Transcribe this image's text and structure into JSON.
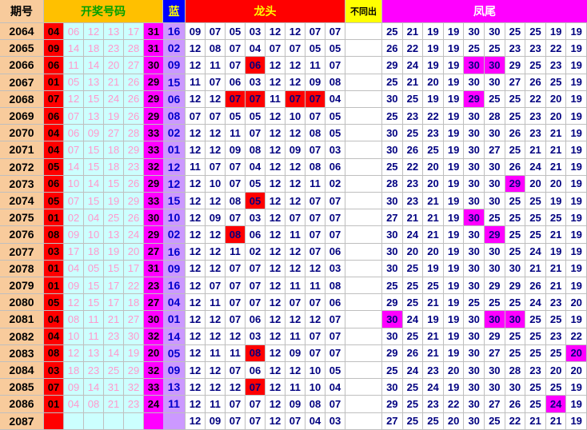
{
  "headers": {
    "period": "期号",
    "numbers": "开奖号码",
    "blue": "蓝",
    "longtou": "龙头",
    "diff": "不同出",
    "fengwei": "凤尾"
  },
  "colors": {
    "header_period_bg": "#f8cb9c",
    "header_numbers_bg": "#ffc000",
    "header_numbers_text": "#00a000",
    "header_blue_bg": "#0000ff",
    "header_blue_text": "#ffff00",
    "header_longtou_bg": "#ff0000",
    "header_longtou_text": "#ffff00",
    "header_diff_bg": "#ffff00",
    "header_fengwei_bg": "#ff00ff",
    "header_fengwei_text": "#ffffff",
    "period_bg": "#f8cb9c",
    "first_bg": "#ff0000",
    "mid_bg": "#ccfffe",
    "mid_text": "#ff99cc",
    "sixth_bg": "#ff00ff",
    "blue_bg": "#cc99ff",
    "blue_text": "#0000cc",
    "grid_text": "#000080",
    "longtou_hl_bg": "#ff0000",
    "fengwei_hl_bg": "#ff00ff"
  },
  "rows": [
    {
      "period": "2064",
      "draw": [
        "04",
        "06",
        "12",
        "13",
        "17",
        "31"
      ],
      "blue": "16",
      "longtou": [
        "09",
        "07",
        "05",
        "03",
        "12",
        "12",
        "07",
        "07"
      ],
      "lt_hl": [],
      "fengwei": [
        "25",
        "21",
        "19",
        "19",
        "30",
        "30",
        "25",
        "25",
        "19",
        "19"
      ],
      "fw_hl": []
    },
    {
      "period": "2065",
      "draw": [
        "09",
        "14",
        "18",
        "23",
        "28",
        "31"
      ],
      "blue": "02",
      "longtou": [
        "12",
        "08",
        "07",
        "04",
        "07",
        "07",
        "05",
        "05"
      ],
      "lt_hl": [],
      "fengwei": [
        "26",
        "22",
        "19",
        "19",
        "25",
        "25",
        "23",
        "23",
        "22",
        "19"
      ],
      "fw_hl": []
    },
    {
      "period": "2066",
      "draw": [
        "06",
        "11",
        "14",
        "20",
        "27",
        "30"
      ],
      "blue": "09",
      "longtou": [
        "12",
        "11",
        "07",
        "06",
        "12",
        "12",
        "11",
        "07"
      ],
      "lt_hl": [
        3
      ],
      "fengwei": [
        "29",
        "24",
        "19",
        "19",
        "30",
        "30",
        "29",
        "25",
        "23",
        "19"
      ],
      "fw_hl": [
        4,
        5
      ]
    },
    {
      "period": "2067",
      "draw": [
        "01",
        "05",
        "13",
        "21",
        "26",
        "29"
      ],
      "blue": "15",
      "longtou": [
        "11",
        "07",
        "06",
        "03",
        "12",
        "12",
        "09",
        "08"
      ],
      "lt_hl": [],
      "fengwei": [
        "25",
        "21",
        "20",
        "19",
        "30",
        "30",
        "27",
        "26",
        "25",
        "19"
      ],
      "fw_hl": []
    },
    {
      "period": "2068",
      "draw": [
        "07",
        "12",
        "15",
        "24",
        "26",
        "29"
      ],
      "blue": "06",
      "longtou": [
        "12",
        "12",
        "07",
        "07",
        "11",
        "07",
        "07",
        "04"
      ],
      "lt_hl": [
        2,
        3,
        5,
        6
      ],
      "fengwei": [
        "30",
        "25",
        "19",
        "19",
        "29",
        "25",
        "25",
        "22",
        "20",
        "19"
      ],
      "fw_hl": [
        4
      ]
    },
    {
      "period": "2069",
      "draw": [
        "06",
        "07",
        "13",
        "19",
        "26",
        "29"
      ],
      "blue": "08",
      "longtou": [
        "07",
        "07",
        "05",
        "05",
        "12",
        "10",
        "07",
        "05"
      ],
      "lt_hl": [],
      "fengwei": [
        "25",
        "23",
        "22",
        "19",
        "30",
        "28",
        "25",
        "23",
        "20",
        "19"
      ],
      "fw_hl": []
    },
    {
      "period": "2070",
      "draw": [
        "04",
        "06",
        "09",
        "27",
        "28",
        "33"
      ],
      "blue": "02",
      "longtou": [
        "12",
        "12",
        "11",
        "07",
        "12",
        "12",
        "08",
        "05"
      ],
      "lt_hl": [],
      "fengwei": [
        "30",
        "25",
        "23",
        "19",
        "30",
        "30",
        "26",
        "23",
        "21",
        "19"
      ],
      "fw_hl": []
    },
    {
      "period": "2071",
      "draw": [
        "04",
        "07",
        "15",
        "18",
        "29",
        "33"
      ],
      "blue": "01",
      "longtou": [
        "12",
        "12",
        "09",
        "08",
        "12",
        "09",
        "07",
        "03"
      ],
      "lt_hl": [],
      "fengwei": [
        "30",
        "26",
        "25",
        "19",
        "30",
        "27",
        "25",
        "21",
        "21",
        "19"
      ],
      "fw_hl": []
    },
    {
      "period": "2072",
      "draw": [
        "05",
        "14",
        "15",
        "18",
        "23",
        "32"
      ],
      "blue": "12",
      "longtou": [
        "11",
        "07",
        "07",
        "04",
        "12",
        "12",
        "08",
        "06"
      ],
      "lt_hl": [],
      "fengwei": [
        "25",
        "22",
        "20",
        "19",
        "30",
        "30",
        "26",
        "24",
        "21",
        "19"
      ],
      "fw_hl": []
    },
    {
      "period": "2073",
      "draw": [
        "06",
        "10",
        "14",
        "15",
        "26",
        "29"
      ],
      "blue": "12",
      "longtou": [
        "12",
        "10",
        "07",
        "05",
        "12",
        "12",
        "11",
        "02"
      ],
      "lt_hl": [],
      "fengwei": [
        "28",
        "23",
        "20",
        "19",
        "30",
        "30",
        "29",
        "20",
        "20",
        "19"
      ],
      "fw_hl": [
        6
      ]
    },
    {
      "period": "2074",
      "draw": [
        "05",
        "07",
        "15",
        "19",
        "29",
        "33"
      ],
      "blue": "15",
      "longtou": [
        "12",
        "12",
        "08",
        "05",
        "12",
        "12",
        "07",
        "07"
      ],
      "lt_hl": [
        3
      ],
      "fengwei": [
        "30",
        "23",
        "21",
        "19",
        "30",
        "30",
        "25",
        "25",
        "19",
        "19"
      ],
      "fw_hl": []
    },
    {
      "period": "2075",
      "draw": [
        "01",
        "02",
        "04",
        "25",
        "26",
        "30"
      ],
      "blue": "10",
      "longtou": [
        "12",
        "09",
        "07",
        "03",
        "12",
        "07",
        "07",
        "07"
      ],
      "lt_hl": [],
      "fengwei": [
        "27",
        "21",
        "21",
        "19",
        "30",
        "25",
        "25",
        "25",
        "25",
        "19"
      ],
      "fw_hl": [
        4
      ]
    },
    {
      "period": "2076",
      "draw": [
        "08",
        "09",
        "10",
        "13",
        "24",
        "29"
      ],
      "blue": "02",
      "longtou": [
        "12",
        "12",
        "08",
        "06",
        "12",
        "11",
        "07",
        "07"
      ],
      "lt_hl": [
        2
      ],
      "fengwei": [
        "30",
        "24",
        "21",
        "19",
        "30",
        "29",
        "25",
        "25",
        "21",
        "19"
      ],
      "fw_hl": [
        5
      ]
    },
    {
      "period": "2077",
      "draw": [
        "03",
        "17",
        "18",
        "19",
        "20",
        "27"
      ],
      "blue": "16",
      "longtou": [
        "12",
        "12",
        "11",
        "02",
        "12",
        "12",
        "07",
        "06"
      ],
      "lt_hl": [],
      "fengwei": [
        "30",
        "20",
        "20",
        "19",
        "30",
        "30",
        "25",
        "24",
        "19",
        "19"
      ],
      "fw_hl": []
    },
    {
      "period": "2078",
      "draw": [
        "01",
        "04",
        "05",
        "15",
        "17",
        "31"
      ],
      "blue": "09",
      "longtou": [
        "12",
        "12",
        "07",
        "07",
        "12",
        "12",
        "12",
        "03"
      ],
      "lt_hl": [],
      "fengwei": [
        "30",
        "25",
        "19",
        "19",
        "30",
        "30",
        "30",
        "21",
        "21",
        "19"
      ],
      "fw_hl": []
    },
    {
      "period": "2079",
      "draw": [
        "01",
        "09",
        "15",
        "17",
        "22",
        "23"
      ],
      "blue": "16",
      "longtou": [
        "12",
        "07",
        "07",
        "07",
        "12",
        "11",
        "11",
        "08"
      ],
      "lt_hl": [],
      "fengwei": [
        "25",
        "25",
        "25",
        "19",
        "30",
        "29",
        "29",
        "26",
        "21",
        "19"
      ],
      "fw_hl": []
    },
    {
      "period": "2080",
      "draw": [
        "05",
        "12",
        "15",
        "17",
        "18",
        "27"
      ],
      "blue": "04",
      "longtou": [
        "12",
        "11",
        "07",
        "07",
        "12",
        "07",
        "07",
        "06"
      ],
      "lt_hl": [],
      "fengwei": [
        "29",
        "25",
        "21",
        "19",
        "25",
        "25",
        "25",
        "24",
        "23",
        "20"
      ],
      "fw_hl": []
    },
    {
      "period": "2081",
      "draw": [
        "04",
        "08",
        "11",
        "21",
        "27",
        "30"
      ],
      "blue": "01",
      "longtou": [
        "12",
        "12",
        "07",
        "06",
        "12",
        "12",
        "12",
        "07"
      ],
      "lt_hl": [],
      "fengwei": [
        "30",
        "24",
        "19",
        "19",
        "30",
        "30",
        "30",
        "25",
        "25",
        "19"
      ],
      "fw_hl": [
        0,
        5,
        6
      ]
    },
    {
      "period": "2082",
      "draw": [
        "04",
        "10",
        "11",
        "23",
        "30",
        "32"
      ],
      "blue": "14",
      "longtou": [
        "12",
        "12",
        "12",
        "03",
        "12",
        "11",
        "07",
        "07"
      ],
      "lt_hl": [],
      "fengwei": [
        "30",
        "25",
        "21",
        "19",
        "30",
        "29",
        "25",
        "25",
        "23",
        "22"
      ],
      "fw_hl": []
    },
    {
      "period": "2083",
      "draw": [
        "08",
        "12",
        "13",
        "14",
        "19",
        "20"
      ],
      "blue": "05",
      "longtou": [
        "12",
        "11",
        "11",
        "08",
        "12",
        "09",
        "07",
        "07"
      ],
      "lt_hl": [
        3
      ],
      "fengwei": [
        "29",
        "26",
        "21",
        "19",
        "30",
        "27",
        "25",
        "25",
        "25",
        "20"
      ],
      "fw_hl": [
        9
      ]
    },
    {
      "period": "2084",
      "draw": [
        "03",
        "18",
        "23",
        "25",
        "29",
        "32"
      ],
      "blue": "09",
      "longtou": [
        "12",
        "12",
        "07",
        "06",
        "12",
        "12",
        "10",
        "05"
      ],
      "lt_hl": [],
      "fengwei": [
        "25",
        "24",
        "23",
        "20",
        "30",
        "30",
        "28",
        "23",
        "20",
        "20"
      ],
      "fw_hl": []
    },
    {
      "period": "2085",
      "draw": [
        "07",
        "09",
        "14",
        "31",
        "32",
        "33"
      ],
      "blue": "13",
      "longtou": [
        "12",
        "12",
        "12",
        "07",
        "12",
        "11",
        "10",
        "04"
      ],
      "lt_hl": [
        3
      ],
      "fengwei": [
        "30",
        "25",
        "24",
        "19",
        "30",
        "30",
        "30",
        "25",
        "25",
        "19"
      ],
      "fw_hl": []
    },
    {
      "period": "2086",
      "draw": [
        "01",
        "04",
        "08",
        "21",
        "23",
        "24"
      ],
      "blue": "11",
      "longtou": [
        "12",
        "11",
        "07",
        "07",
        "12",
        "09",
        "08",
        "07"
      ],
      "lt_hl": [],
      "fengwei": [
        "29",
        "25",
        "23",
        "22",
        "30",
        "27",
        "26",
        "25",
        "24",
        "19"
      ],
      "fw_hl": [
        8
      ]
    },
    {
      "period": "2087",
      "draw": [
        "",
        "",
        "",
        "",
        "",
        ""
      ],
      "blue": "",
      "longtou": [
        "12",
        "09",
        "07",
        "07",
        "12",
        "07",
        "04",
        "03"
      ],
      "lt_hl": [],
      "fengwei": [
        "27",
        "25",
        "25",
        "20",
        "30",
        "25",
        "22",
        "21",
        "21",
        "19"
      ],
      "fw_hl": []
    }
  ]
}
